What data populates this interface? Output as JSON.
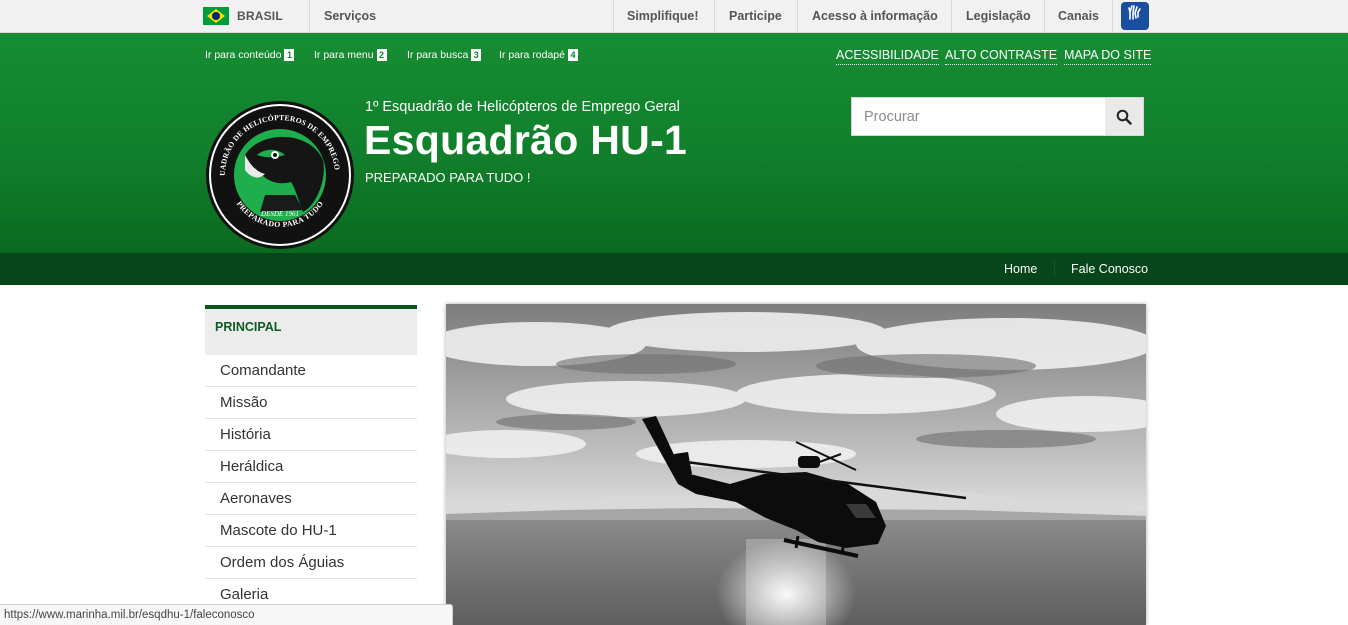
{
  "govbar": {
    "country": "BRASIL",
    "services": "Serviços",
    "links": [
      "Simplifique!",
      "Participe",
      "Acesso à informação",
      "Legislação",
      "Canais"
    ],
    "vlibras_icon": "vlibras-hands-icon"
  },
  "skip_links": [
    {
      "label": "Ir para conteúdo",
      "key": "1"
    },
    {
      "label": "Ir para menu",
      "key": "2"
    },
    {
      "label": "Ir para busca",
      "key": "3"
    },
    {
      "label": "Ir para rodapé",
      "key": "4"
    }
  ],
  "accessibility_links": [
    "ACESSIBILIDADE",
    "ALTO CONTRASTE",
    "MAPA DO SITE"
  ],
  "site": {
    "subtitle": "1º Esquadrão de Helicópteros de Emprego Geral",
    "title": "Esquadrão HU-1",
    "slogan": "PREPARADO PARA TUDO !",
    "logo_ring_top": "1º ESQUADRÃO DE HELICÓPTEROS DE EMPREGO GERAL",
    "logo_ring_bottom": "PREPARADO PARA TUDO",
    "logo_since": "DESDE 1961"
  },
  "search": {
    "placeholder": "Procurar",
    "icon": "search-icon"
  },
  "nav": {
    "home": "Home",
    "contact": "Fale Conosco"
  },
  "sidebar": {
    "heading": "PRINCIPAL",
    "items": [
      "Comandante",
      "Missão",
      "História",
      "Heráldica",
      "Aeronaves",
      "Mascote do HU-1",
      "Ordem dos Águias",
      "Galeria"
    ]
  },
  "status_url": "https://www.marinha.mil.br/esqdhu-1/faleconosco",
  "colors": {
    "brand_green": "#117f2b",
    "nav_dark_green": "#06461a",
    "sidebar_heading": "#0d5a23"
  }
}
